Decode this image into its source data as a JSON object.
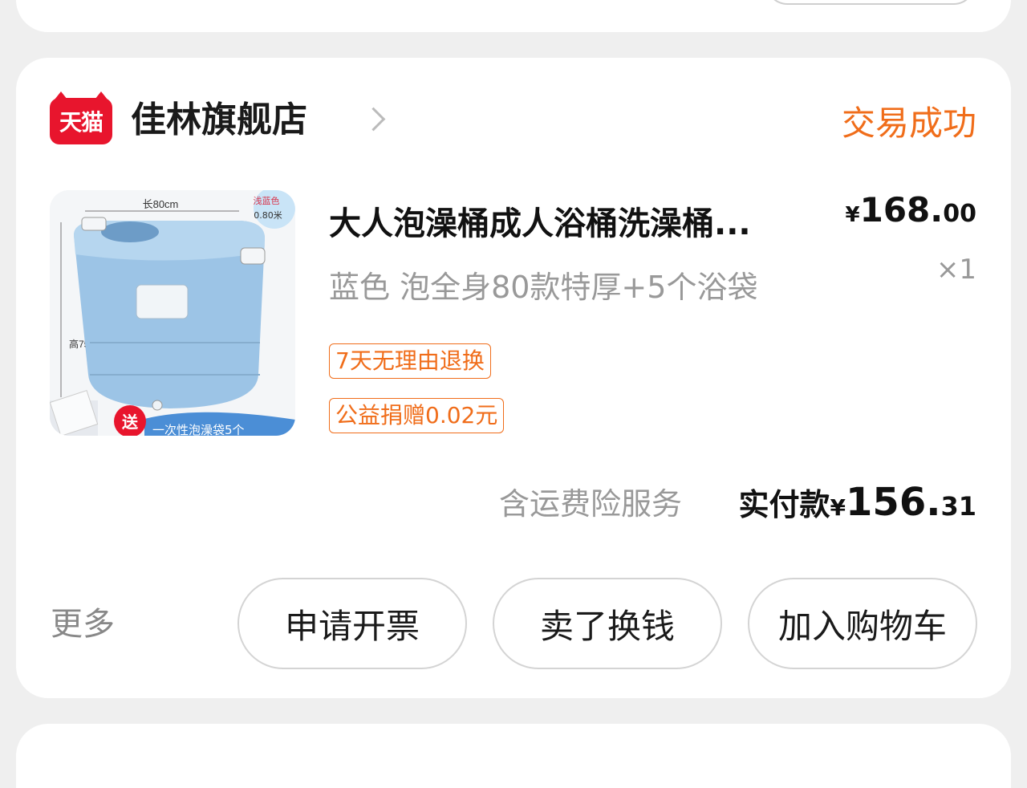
{
  "store": {
    "platform_logo_text": "天猫",
    "name": "佳林旗舰店",
    "status": "交易成功"
  },
  "product": {
    "title": "大人泡澡桶成人浴桶洗澡桶...",
    "sku": "蓝色 泡全身80款特厚+5个浴袋",
    "price_currency": "¥",
    "price_integer": "168.",
    "price_decimal": "00",
    "quantity": "×1",
    "image": {
      "width_label": "长80cm",
      "height_label": "高75cm",
      "color_badge_line1": "浅蓝色",
      "color_badge_line2": "0.80米",
      "gift_badge": "送",
      "banner_text": "一次性泡澡袋5个"
    },
    "tags": [
      "7天无理由退换",
      "公益捐赠0.02元"
    ]
  },
  "summary": {
    "insurance": "含运费险服务",
    "paid_label": "实付款",
    "paid_currency": "¥",
    "paid_integer": "156.",
    "paid_decimal": "31"
  },
  "actions": {
    "more": "更多",
    "invoice": "申请开票",
    "sell": "卖了换钱",
    "add_to_cart": "加入购物车"
  },
  "colors": {
    "accent_orange": "#f06d1a",
    "tmall_red": "#e8152d",
    "product_blue": "#9cc4e6"
  }
}
